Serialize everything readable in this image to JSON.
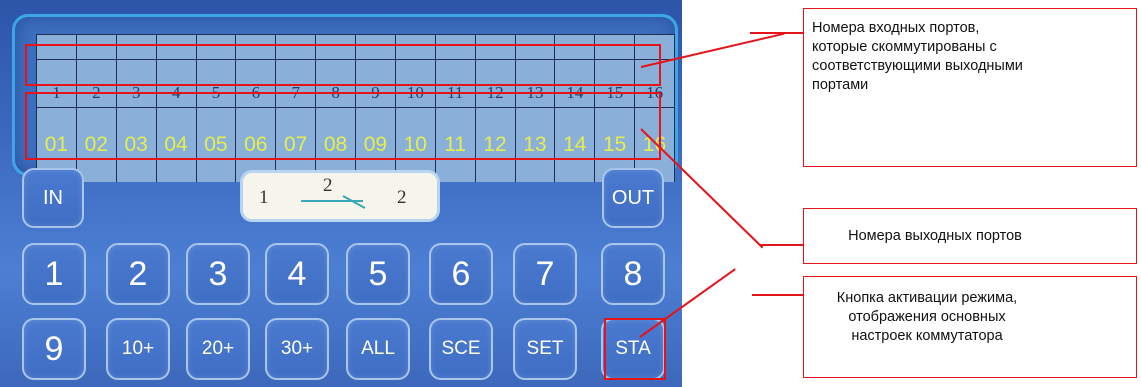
{
  "matrix": {
    "input_ports": [
      "1",
      "2",
      "3",
      "4",
      "5",
      "6",
      "7",
      "8",
      "9",
      "10",
      "11",
      "12",
      "13",
      "14",
      "15",
      "16"
    ],
    "output_ports": [
      "01",
      "02",
      "03",
      "04",
      "05",
      "06",
      "07",
      "08",
      "09",
      "10",
      "11",
      "12",
      "13",
      "14",
      "15",
      "16"
    ]
  },
  "display": {
    "input": "1",
    "middle": "2",
    "output": "2"
  },
  "buttons": {
    "in": "IN",
    "out": "OUT",
    "row1": [
      "1",
      "2",
      "3",
      "4",
      "5",
      "6",
      "7",
      "8"
    ],
    "row2": [
      "9",
      "10+",
      "20+",
      "30+",
      "ALL",
      "SCE",
      "SET",
      "STA"
    ]
  },
  "callouts": {
    "input_ports": "Номера входных портов, которые скоммутированы с соответствующими выходными портами",
    "output_ports": "Номера выходных портов",
    "sta_button": "Кнопка активации режима, отображения основных настроек коммутатора"
  },
  "colors": {
    "panel_blue": "#3e6cc3",
    "output_number_yellow": "#e6ee4c",
    "highlight_red": "#e5141b",
    "button_border": "#a8c6ec"
  }
}
